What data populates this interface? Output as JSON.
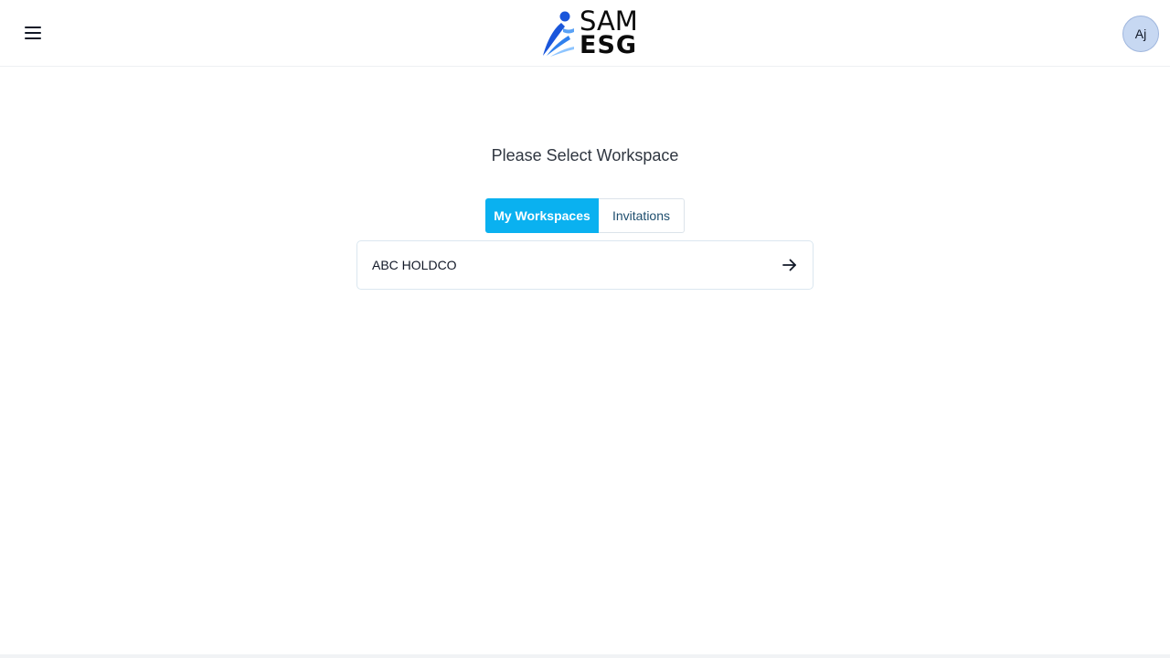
{
  "header": {
    "menu_icon": "hamburger-menu-icon",
    "logo": {
      "line1": "SAM",
      "line2": "ESG",
      "mark_colors": [
        "#1a56db",
        "#2f80ed",
        "#8ec5ff"
      ]
    },
    "avatar_initials": "Aj",
    "avatar_color": "#c7d8f2"
  },
  "main": {
    "title": "Please Select Workspace",
    "tabs": [
      {
        "label": "My Workspaces",
        "active": true
      },
      {
        "label": "Invitations",
        "active": false
      }
    ],
    "workspaces": [
      {
        "name": "ABC HOLDCO",
        "icon": "arrow-right-icon"
      }
    ]
  },
  "colors": {
    "accent": "#0ab1f0",
    "inactive_tab_text": "#1e4e6e",
    "border": "#dbe7f0"
  }
}
